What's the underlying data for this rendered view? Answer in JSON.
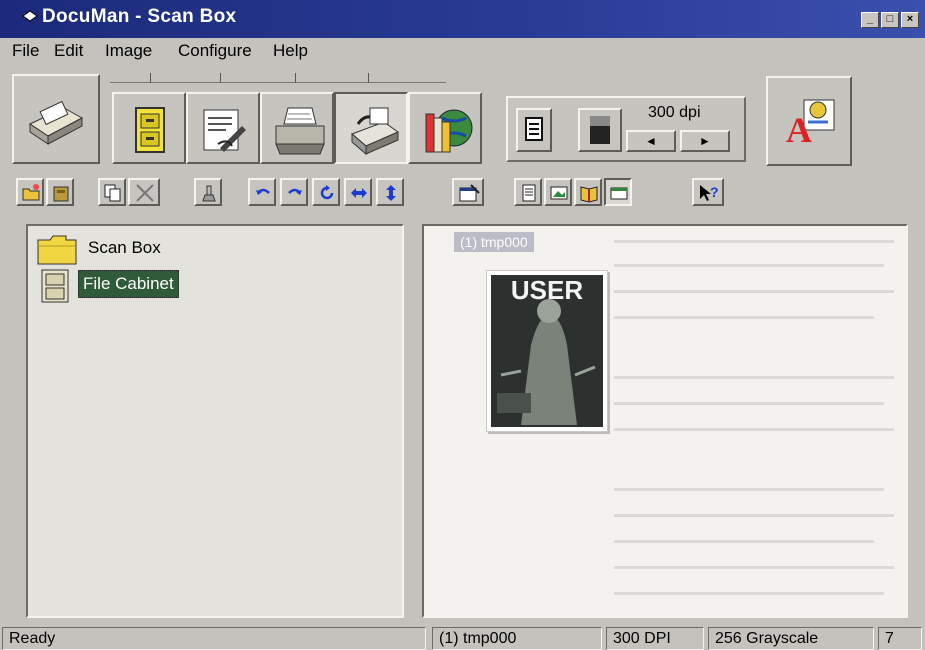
{
  "window": {
    "title": "DocuMan - Scan Box",
    "buttons": [
      "minimize",
      "maximize",
      "close"
    ]
  },
  "menu": [
    "File",
    "Edit",
    "Image",
    "Configure",
    "Help"
  ],
  "toolbar": {
    "dpi_label": "300 dpi",
    "left_arrow": "◄",
    "right_arrow": "►",
    "big_buttons": [
      "scanner-icon",
      "file-cabinet-icon",
      "edit-document-icon",
      "printer-icon",
      "fax-icon",
      "globe-books-icon",
      "document-mode-icon",
      "grayscale-icon",
      "ocr-icon"
    ]
  },
  "tools": [
    "new-folder-icon",
    "folder-icon",
    "copy-icon",
    "delete-icon",
    "stamp-icon",
    "undo-icon",
    "redo-icon",
    "rotate-icon",
    "flip-horizontal-icon",
    "flip-vertical-icon",
    "properties-icon",
    "page-view-icon",
    "thumbnail-view-icon",
    "book-view-icon",
    "window-view-icon",
    "help-icon"
  ],
  "tree": {
    "items": [
      {
        "label": "Scan Box",
        "icon": "folder-icon"
      },
      {
        "label": "File Cabinet",
        "icon": "cabinet-icon",
        "selected": true
      }
    ]
  },
  "preview": {
    "thumb_label": "(1) tmp000",
    "thumb_title": "USER"
  },
  "status": {
    "ready": "Ready",
    "file": "(1) tmp000",
    "dpi": "300 DPI",
    "mode": "256 Grayscale",
    "count": "7"
  },
  "colors": {
    "titlebar": "#1b2a7a",
    "selection": "#2f5b3a",
    "panel": "#c4c2bd"
  }
}
